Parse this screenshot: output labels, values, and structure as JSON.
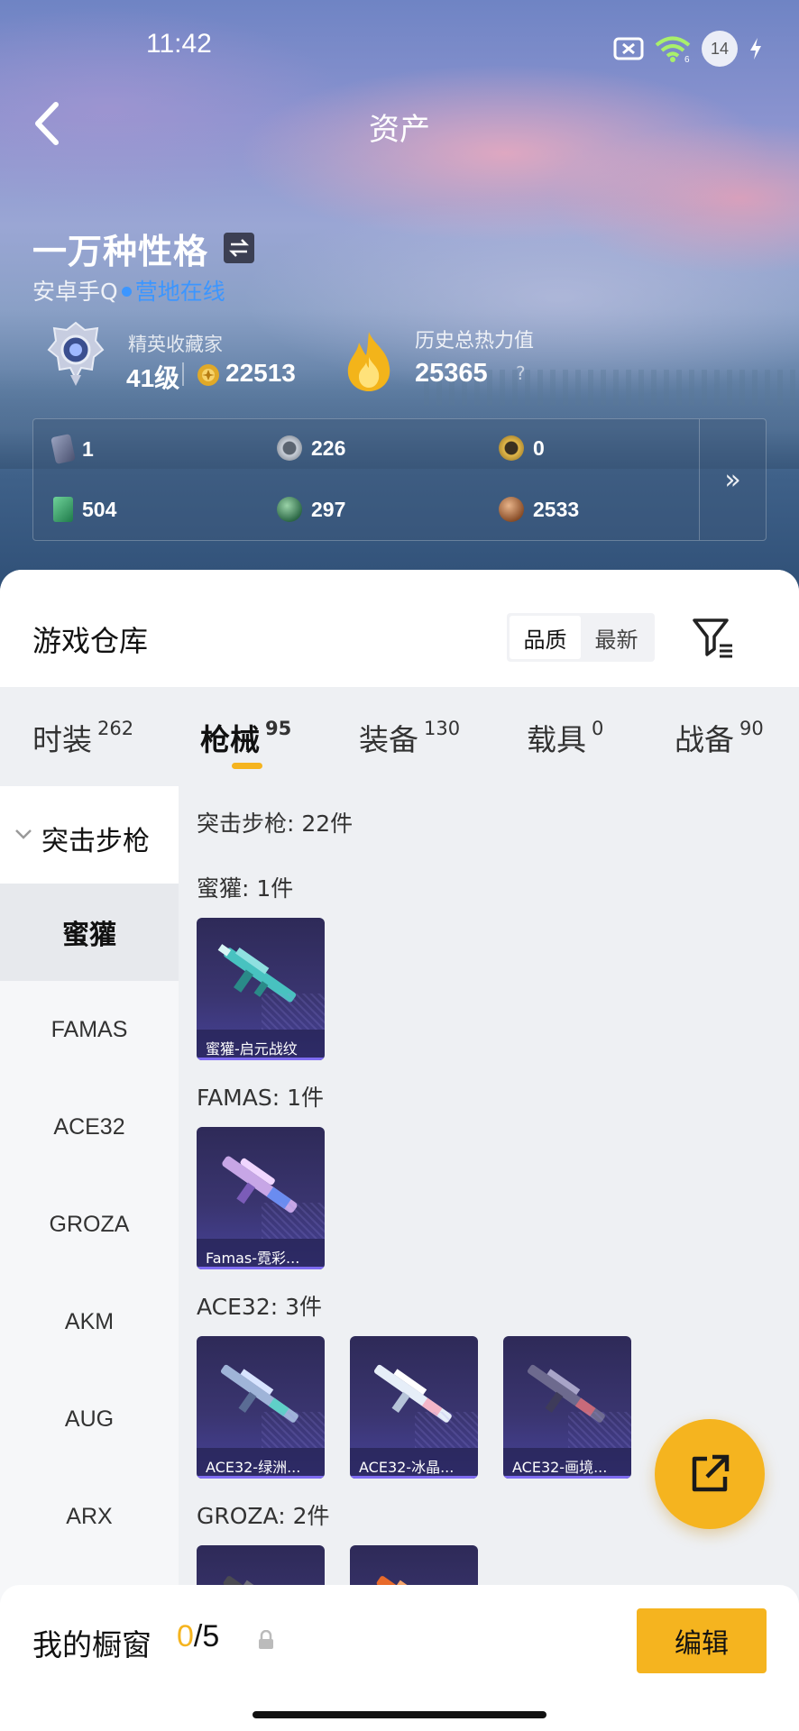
{
  "status_bar": {
    "time": "11:42",
    "battery_level": "14"
  },
  "nav": {
    "title": "资产"
  },
  "profile": {
    "name": "一万种性格",
    "platform": "安卓手Q",
    "online_status": "营地在线",
    "rank_title": "精英收藏家",
    "level": "41级",
    "coins": "22513",
    "heat_title": "历史总热力值",
    "heat_value": "25365",
    "heat_help": "?"
  },
  "stats": [
    {
      "icon": "card-icon",
      "value": "1",
      "color": "#6e7590"
    },
    {
      "icon": "silver-medal-icon",
      "value": "226",
      "color": "#9aa0a8"
    },
    {
      "icon": "gold-badge-icon",
      "value": "0",
      "color": "#c9a23a"
    },
    {
      "icon": "green-card-icon",
      "value": "504",
      "color": "#3ea66a"
    },
    {
      "icon": "green-orb-icon",
      "value": "297",
      "color": "#4c8f6a"
    },
    {
      "icon": "bronze-orb-icon",
      "value": "2533",
      "color": "#a0643a"
    }
  ],
  "stats_more": "»",
  "warehouse": {
    "title": "游戏仓库",
    "sort_options": [
      "品质",
      "最新"
    ],
    "sort_selected": "品质"
  },
  "tabs": [
    {
      "label": "时装",
      "count": "262"
    },
    {
      "label": "枪械",
      "count": "95",
      "active": true
    },
    {
      "label": "装备",
      "count": "130"
    },
    {
      "label": "载具",
      "count": "0"
    },
    {
      "label": "战备",
      "count": "90"
    }
  ],
  "sidebar": {
    "group": "突击步枪",
    "items": [
      "蜜獾",
      "FAMAS",
      "ACE32",
      "GROZA",
      "AKM",
      "AUG",
      "ARX"
    ],
    "active": "蜜獾"
  },
  "content": {
    "header": "突击步枪: 22件",
    "sections": [
      {
        "label": "蜜獾: 1件",
        "items": [
          "蜜獾-启元战纹"
        ]
      },
      {
        "label": "FAMAS: 1件",
        "items": [
          "Famas-霓彩..."
        ]
      },
      {
        "label": "ACE32: 3件",
        "items": [
          "ACE32-绿洲...",
          "ACE32-冰晶...",
          "ACE32-画境..."
        ]
      },
      {
        "label": "GROZA: 2件",
        "items": [
          "",
          ""
        ]
      }
    ]
  },
  "showcase": {
    "title": "我的橱窗",
    "current": "0",
    "total": "/5",
    "edit_label": "编辑"
  },
  "colors": {
    "accent": "#f5b41f",
    "online": "#3c96ff",
    "card_bg": "#3a3570"
  }
}
